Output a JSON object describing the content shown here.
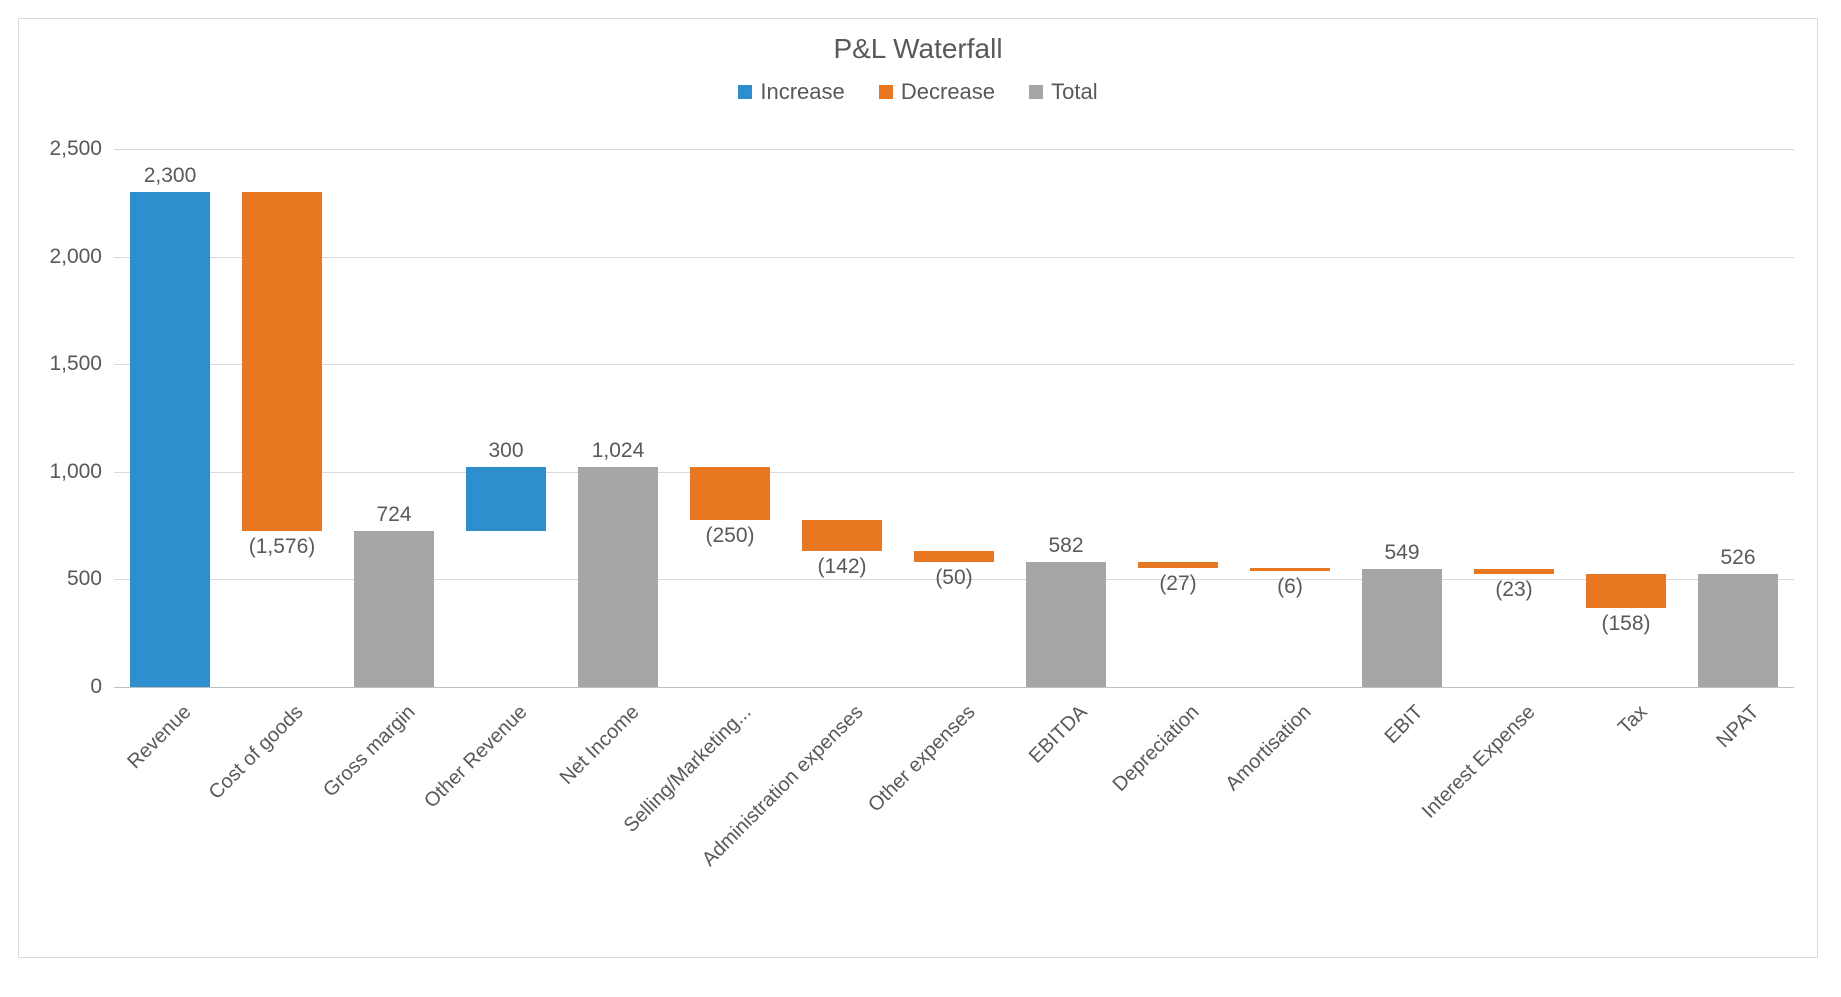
{
  "chart_data": {
    "type": "waterfall",
    "title": "P&L Waterfall",
    "legend": [
      {
        "name": "Increase",
        "cls": "c-inc"
      },
      {
        "name": "Decrease",
        "cls": "c-dec"
      },
      {
        "name": "Total",
        "cls": "c-tot"
      }
    ],
    "ylim": [
      0,
      2500
    ],
    "yticks": [
      0,
      500,
      1000,
      1500,
      2000,
      2500
    ],
    "ytick_labels": [
      "0",
      "500",
      "1,000",
      "1,500",
      "2,000",
      "2,500"
    ],
    "categories": [
      "Revenue",
      "Cost of goods",
      "Gross margin",
      "Other Revenue",
      "Net Income",
      "Selling/Marketing...",
      "Administration expenses",
      "Other expenses",
      "EBITDA",
      "Depreciation",
      "Amortisation",
      "EBIT",
      "Interest Expense",
      "Tax",
      "NPAT"
    ],
    "bars": [
      {
        "kind": "increase",
        "value": 2300,
        "label": "2,300",
        "base": 0,
        "top": 2300
      },
      {
        "kind": "decrease",
        "value": -1576,
        "label": "(1,576)",
        "base": 724,
        "top": 2300
      },
      {
        "kind": "total",
        "value": 724,
        "label": "724",
        "base": 0,
        "top": 724
      },
      {
        "kind": "increase",
        "value": 300,
        "label": "300",
        "base": 724,
        "top": 1024
      },
      {
        "kind": "total",
        "value": 1024,
        "label": "1,024",
        "base": 0,
        "top": 1024
      },
      {
        "kind": "decrease",
        "value": -250,
        "label": "(250)",
        "base": 774,
        "top": 1024
      },
      {
        "kind": "decrease",
        "value": -142,
        "label": "(142)",
        "base": 632,
        "top": 774
      },
      {
        "kind": "decrease",
        "value": -50,
        "label": "(50)",
        "base": 582,
        "top": 632
      },
      {
        "kind": "total",
        "value": 582,
        "label": "582",
        "base": 0,
        "top": 582
      },
      {
        "kind": "decrease",
        "value": -27,
        "label": "(27)",
        "base": 555,
        "top": 582
      },
      {
        "kind": "decrease",
        "value": -6,
        "label": "(6)",
        "base": 549,
        "top": 555
      },
      {
        "kind": "total",
        "value": 549,
        "label": "549",
        "base": 0,
        "top": 549
      },
      {
        "kind": "decrease",
        "value": -23,
        "label": "(23)",
        "base": 526,
        "top": 549
      },
      {
        "kind": "decrease",
        "value": -158,
        "label": "(158)",
        "base": 368,
        "top": 526
      },
      {
        "kind": "total",
        "value": 526,
        "label": "526",
        "base": 0,
        "top": 526
      }
    ]
  }
}
